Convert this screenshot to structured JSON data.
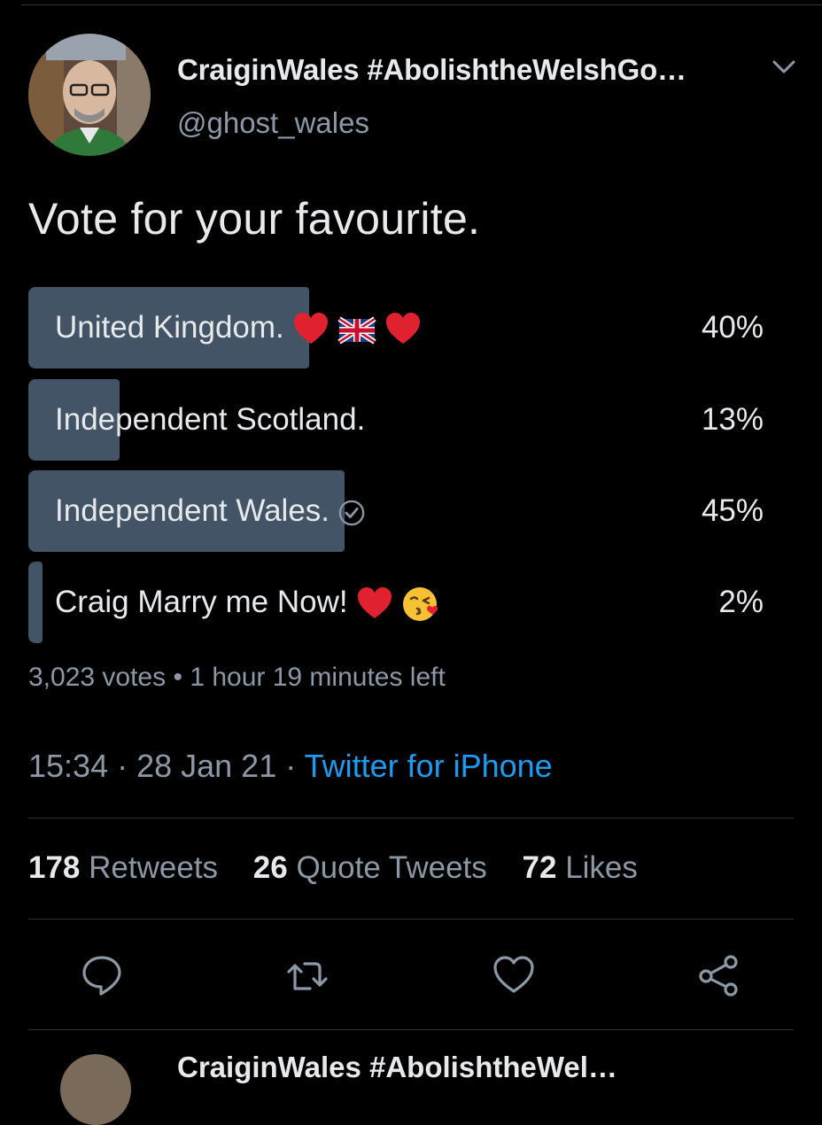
{
  "author": {
    "display_name": "CraiginWales #AbolishtheWelshGo…",
    "handle": "@ghost_wales"
  },
  "tweet": {
    "text": "Vote for your favourite."
  },
  "poll": {
    "options": [
      {
        "label": "United Kingdom.",
        "percent_text": "40%",
        "percent": 40,
        "emoji": [
          "heart",
          "uk-flag",
          "heart"
        ]
      },
      {
        "label": "Independent Scotland.",
        "percent_text": "13%",
        "percent": 13,
        "emoji": []
      },
      {
        "label": "Independent Wales.",
        "percent_text": "45%",
        "percent": 45,
        "emoji": [
          "check-circle"
        ],
        "winner": true
      },
      {
        "label": "Craig Marry me Now!",
        "percent_text": "2%",
        "percent": 2,
        "emoji": [
          "heart",
          "kissing-face"
        ]
      }
    ],
    "votes": "3,023 votes",
    "separator": " • ",
    "time_left": "1 hour 19 minutes left"
  },
  "meta": {
    "time": "15:34",
    "sep": " · ",
    "date": "28 Jan 21",
    "source": "Twitter for iPhone"
  },
  "stats": {
    "retweets_count": "178",
    "retweets_label": "Retweets",
    "quotes_count": "26",
    "quotes_label": "Quote Tweets",
    "likes_count": "72",
    "likes_label": "Likes"
  },
  "next_tweet": {
    "display_name": "CraiginWales #AbolishtheWel…"
  },
  "colors": {
    "background": "#000000",
    "poll_bar": "#425466",
    "link": "#1d9bf0",
    "secondary_text": "#8b98a5",
    "heart": "#e0212f"
  }
}
